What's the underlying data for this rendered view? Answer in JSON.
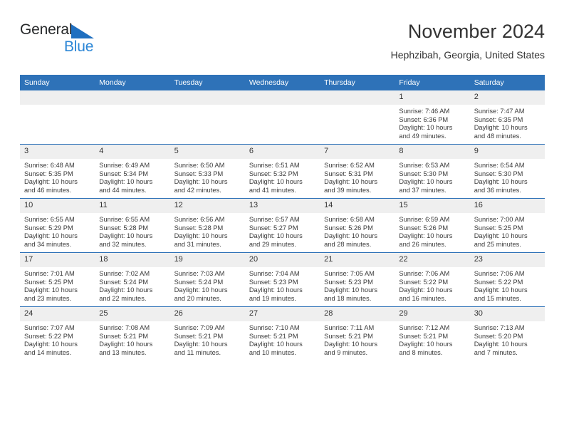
{
  "brand": {
    "name_part1": "General",
    "name_part2": "Blue",
    "triangle_color": "#1f6fc0",
    "text_color_part2": "#2b86d6"
  },
  "header": {
    "title": "November 2024",
    "subtitle": "Hephzibah, Georgia, United States"
  },
  "theme": {
    "header_blue": "#2e72b8",
    "daynum_gray": "#efefef",
    "body_text": "#3a3a3a"
  },
  "weekdays": [
    "Sunday",
    "Monday",
    "Tuesday",
    "Wednesday",
    "Thursday",
    "Friday",
    "Saturday"
  ],
  "weeks": [
    [
      {
        "day": "",
        "empty": true
      },
      {
        "day": "",
        "empty": true
      },
      {
        "day": "",
        "empty": true
      },
      {
        "day": "",
        "empty": true
      },
      {
        "day": "",
        "empty": true
      },
      {
        "day": "1",
        "sunrise": "Sunrise: 7:46 AM",
        "sunset": "Sunset: 6:36 PM",
        "daylight1": "Daylight: 10 hours",
        "daylight2": "and 49 minutes."
      },
      {
        "day": "2",
        "sunrise": "Sunrise: 7:47 AM",
        "sunset": "Sunset: 6:35 PM",
        "daylight1": "Daylight: 10 hours",
        "daylight2": "and 48 minutes."
      }
    ],
    [
      {
        "day": "3",
        "sunrise": "Sunrise: 6:48 AM",
        "sunset": "Sunset: 5:35 PM",
        "daylight1": "Daylight: 10 hours",
        "daylight2": "and 46 minutes."
      },
      {
        "day": "4",
        "sunrise": "Sunrise: 6:49 AM",
        "sunset": "Sunset: 5:34 PM",
        "daylight1": "Daylight: 10 hours",
        "daylight2": "and 44 minutes."
      },
      {
        "day": "5",
        "sunrise": "Sunrise: 6:50 AM",
        "sunset": "Sunset: 5:33 PM",
        "daylight1": "Daylight: 10 hours",
        "daylight2": "and 42 minutes."
      },
      {
        "day": "6",
        "sunrise": "Sunrise: 6:51 AM",
        "sunset": "Sunset: 5:32 PM",
        "daylight1": "Daylight: 10 hours",
        "daylight2": "and 41 minutes."
      },
      {
        "day": "7",
        "sunrise": "Sunrise: 6:52 AM",
        "sunset": "Sunset: 5:31 PM",
        "daylight1": "Daylight: 10 hours",
        "daylight2": "and 39 minutes."
      },
      {
        "day": "8",
        "sunrise": "Sunrise: 6:53 AM",
        "sunset": "Sunset: 5:30 PM",
        "daylight1": "Daylight: 10 hours",
        "daylight2": "and 37 minutes."
      },
      {
        "day": "9",
        "sunrise": "Sunrise: 6:54 AM",
        "sunset": "Sunset: 5:30 PM",
        "daylight1": "Daylight: 10 hours",
        "daylight2": "and 36 minutes."
      }
    ],
    [
      {
        "day": "10",
        "sunrise": "Sunrise: 6:55 AM",
        "sunset": "Sunset: 5:29 PM",
        "daylight1": "Daylight: 10 hours",
        "daylight2": "and 34 minutes."
      },
      {
        "day": "11",
        "sunrise": "Sunrise: 6:55 AM",
        "sunset": "Sunset: 5:28 PM",
        "daylight1": "Daylight: 10 hours",
        "daylight2": "and 32 minutes."
      },
      {
        "day": "12",
        "sunrise": "Sunrise: 6:56 AM",
        "sunset": "Sunset: 5:28 PM",
        "daylight1": "Daylight: 10 hours",
        "daylight2": "and 31 minutes."
      },
      {
        "day": "13",
        "sunrise": "Sunrise: 6:57 AM",
        "sunset": "Sunset: 5:27 PM",
        "daylight1": "Daylight: 10 hours",
        "daylight2": "and 29 minutes."
      },
      {
        "day": "14",
        "sunrise": "Sunrise: 6:58 AM",
        "sunset": "Sunset: 5:26 PM",
        "daylight1": "Daylight: 10 hours",
        "daylight2": "and 28 minutes."
      },
      {
        "day": "15",
        "sunrise": "Sunrise: 6:59 AM",
        "sunset": "Sunset: 5:26 PM",
        "daylight1": "Daylight: 10 hours",
        "daylight2": "and 26 minutes."
      },
      {
        "day": "16",
        "sunrise": "Sunrise: 7:00 AM",
        "sunset": "Sunset: 5:25 PM",
        "daylight1": "Daylight: 10 hours",
        "daylight2": "and 25 minutes."
      }
    ],
    [
      {
        "day": "17",
        "sunrise": "Sunrise: 7:01 AM",
        "sunset": "Sunset: 5:25 PM",
        "daylight1": "Daylight: 10 hours",
        "daylight2": "and 23 minutes."
      },
      {
        "day": "18",
        "sunrise": "Sunrise: 7:02 AM",
        "sunset": "Sunset: 5:24 PM",
        "daylight1": "Daylight: 10 hours",
        "daylight2": "and 22 minutes."
      },
      {
        "day": "19",
        "sunrise": "Sunrise: 7:03 AM",
        "sunset": "Sunset: 5:24 PM",
        "daylight1": "Daylight: 10 hours",
        "daylight2": "and 20 minutes."
      },
      {
        "day": "20",
        "sunrise": "Sunrise: 7:04 AM",
        "sunset": "Sunset: 5:23 PM",
        "daylight1": "Daylight: 10 hours",
        "daylight2": "and 19 minutes."
      },
      {
        "day": "21",
        "sunrise": "Sunrise: 7:05 AM",
        "sunset": "Sunset: 5:23 PM",
        "daylight1": "Daylight: 10 hours",
        "daylight2": "and 18 minutes."
      },
      {
        "day": "22",
        "sunrise": "Sunrise: 7:06 AM",
        "sunset": "Sunset: 5:22 PM",
        "daylight1": "Daylight: 10 hours",
        "daylight2": "and 16 minutes."
      },
      {
        "day": "23",
        "sunrise": "Sunrise: 7:06 AM",
        "sunset": "Sunset: 5:22 PM",
        "daylight1": "Daylight: 10 hours",
        "daylight2": "and 15 minutes."
      }
    ],
    [
      {
        "day": "24",
        "sunrise": "Sunrise: 7:07 AM",
        "sunset": "Sunset: 5:22 PM",
        "daylight1": "Daylight: 10 hours",
        "daylight2": "and 14 minutes."
      },
      {
        "day": "25",
        "sunrise": "Sunrise: 7:08 AM",
        "sunset": "Sunset: 5:21 PM",
        "daylight1": "Daylight: 10 hours",
        "daylight2": "and 13 minutes."
      },
      {
        "day": "26",
        "sunrise": "Sunrise: 7:09 AM",
        "sunset": "Sunset: 5:21 PM",
        "daylight1": "Daylight: 10 hours",
        "daylight2": "and 11 minutes."
      },
      {
        "day": "27",
        "sunrise": "Sunrise: 7:10 AM",
        "sunset": "Sunset: 5:21 PM",
        "daylight1": "Daylight: 10 hours",
        "daylight2": "and 10 minutes."
      },
      {
        "day": "28",
        "sunrise": "Sunrise: 7:11 AM",
        "sunset": "Sunset: 5:21 PM",
        "daylight1": "Daylight: 10 hours",
        "daylight2": "and 9 minutes."
      },
      {
        "day": "29",
        "sunrise": "Sunrise: 7:12 AM",
        "sunset": "Sunset: 5:21 PM",
        "daylight1": "Daylight: 10 hours",
        "daylight2": "and 8 minutes."
      },
      {
        "day": "30",
        "sunrise": "Sunrise: 7:13 AM",
        "sunset": "Sunset: 5:20 PM",
        "daylight1": "Daylight: 10 hours",
        "daylight2": "and 7 minutes."
      }
    ]
  ]
}
